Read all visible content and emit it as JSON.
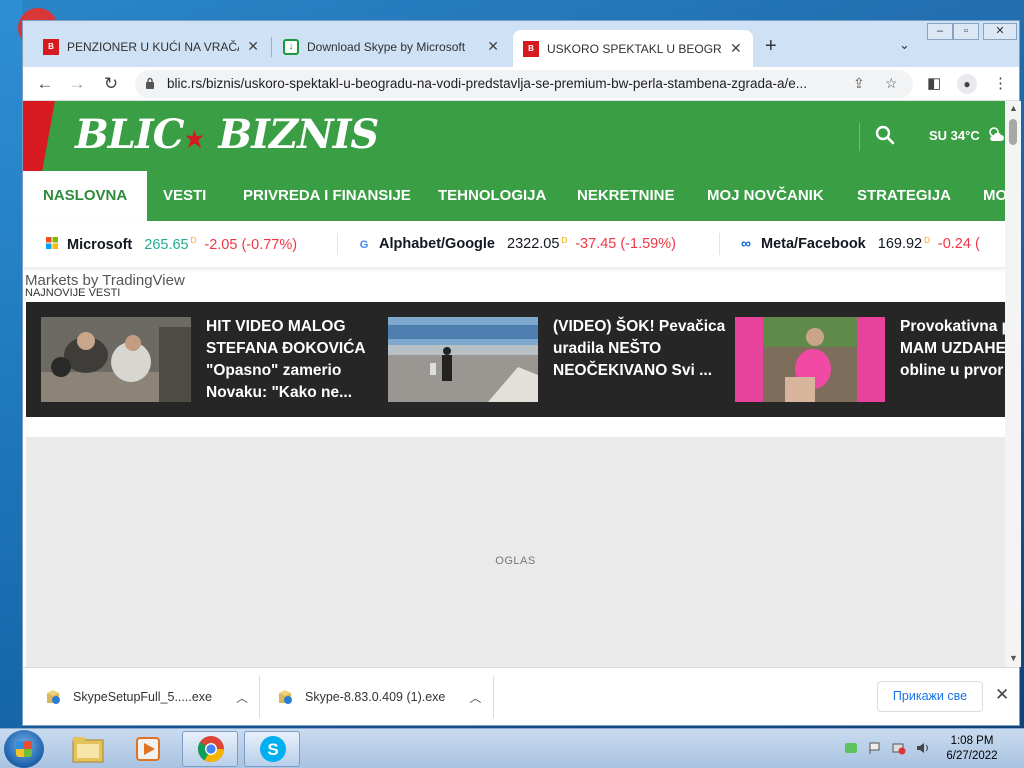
{
  "browser": {
    "tabs": [
      {
        "title": "PENZIONER U KUĆI NA VRAČAR",
        "favicon": "blic-icon",
        "active": false
      },
      {
        "title": "Download Skype by Microsoft",
        "favicon": "download-icon",
        "active": false
      },
      {
        "title": "USKORO SPEKTAKL U BEOGRAD",
        "favicon": "blic-icon",
        "active": true
      }
    ],
    "url": "blic.rs/biznis/uskoro-spektakl-u-beogradu-na-vodi-predstavlja-se-premium-bw-perla-stambena-zgrada-a/e..."
  },
  "site": {
    "logo_left": "BLIC",
    "logo_right": "BIZNIS",
    "weather": "SU 34°C",
    "brand_color": "#3a9e45",
    "accent_color": "#d71920"
  },
  "nav": [
    {
      "label": "NASLOVNA",
      "active": true
    },
    {
      "label": "VESTI",
      "active": false
    },
    {
      "label": "PRIVREDA I FINANSIJE",
      "active": false
    },
    {
      "label": "TEHNOLOGIJA",
      "active": false
    },
    {
      "label": "NEKRETNINE",
      "active": false
    },
    {
      "label": "MOJ NOVČANIK",
      "active": false
    },
    {
      "label": "STRATEGIJA",
      "active": false
    },
    {
      "label": "MO",
      "active": false
    }
  ],
  "ticker": [
    {
      "name": "Microsoft",
      "price": "265.65",
      "change": "-2.05 (-0.77%)",
      "icon": "microsoft-icon"
    },
    {
      "name": "Alphabet/Google",
      "price": "2322.05",
      "change": "-37.45 (-1.59%)",
      "icon": "google-icon"
    },
    {
      "name": "Meta/Facebook",
      "price": "169.92",
      "change": "-0.24 (",
      "icon": "meta-icon"
    }
  ],
  "tradingview_label": "Markets by TradingView",
  "latest_label": "NAJNOVIJE VESTI",
  "news": [
    {
      "title": "HIT VIDEO MALOG STEFANA ĐOKOVIĆA \"Opasno\" zamerio Novaku: \"Kako ne..."
    },
    {
      "title": "(VIDEO) ŠOK! Pevačica uradila NEŠTO NEOČEKIVANO Svi ..."
    },
    {
      "title": "Provokativna ponovo MAM UZDAHE: Bujn obline u prvor"
    }
  ],
  "ad_label": "OGLAS",
  "downloads": [
    {
      "filename": "SkypeSetupFull_5.....exe"
    },
    {
      "filename": "Skype-8.83.0.409 (1).exe"
    }
  ],
  "show_all_label": "Прикажи све",
  "taskbar": {
    "time": "1:08 PM",
    "date": "6/27/2022"
  }
}
